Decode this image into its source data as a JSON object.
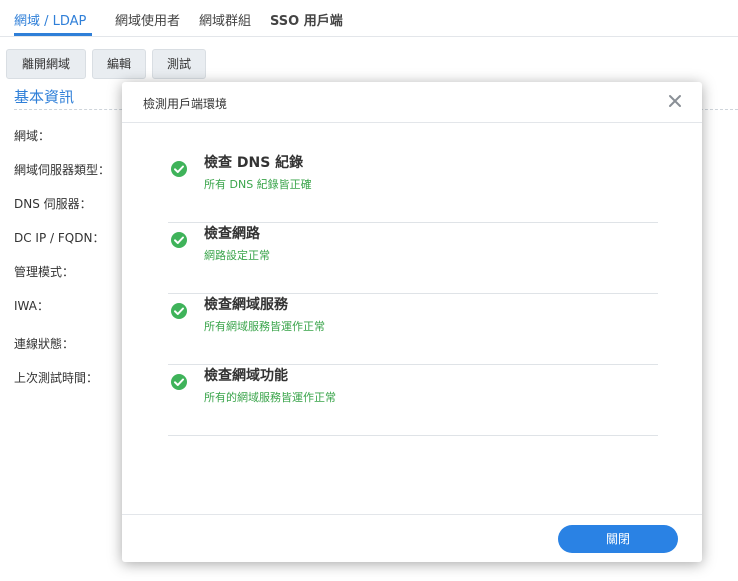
{
  "tabs": [
    {
      "label": "網域 / LDAP"
    },
    {
      "label": "網域使用者"
    },
    {
      "label": "網域群組"
    },
    {
      "label": "SSO 用戶端"
    }
  ],
  "toolbar": {
    "leave_domain_label": "離開網域",
    "edit_label": "編輯",
    "test_label": "測試"
  },
  "basic_info": {
    "title": "基本資訊",
    "fields": [
      {
        "label": "網域："
      },
      {
        "label": "網域伺服器類型："
      },
      {
        "label": "DNS 伺服器："
      },
      {
        "label": "DC IP / FQDN："
      },
      {
        "label": "管理模式："
      },
      {
        "label": "IWA："
      },
      {
        "label": "連線狀態："
      },
      {
        "label": "上次測試時間："
      }
    ]
  },
  "dialog": {
    "title": "檢測用戶端環境",
    "close_label": "關閉",
    "items": [
      {
        "title": "檢查 DNS 紀錄",
        "desc": "所有 DNS 紀錄皆正確",
        "status": "ok"
      },
      {
        "title": "檢查網路",
        "desc": "網路設定正常",
        "status": "ok"
      },
      {
        "title": "檢查網域服務",
        "desc": "所有網域服務皆運作正常",
        "status": "ok"
      },
      {
        "title": "檢查網域功能",
        "desc": "所有的網域服務皆運作正常",
        "status": "ok"
      }
    ]
  },
  "colors": {
    "accent": "#2f7fd8",
    "success": "#3fb35a",
    "primary_button": "#2a82e4"
  },
  "icons": {
    "status_ok": "check-circle-icon",
    "dialog_close": "close-icon"
  }
}
